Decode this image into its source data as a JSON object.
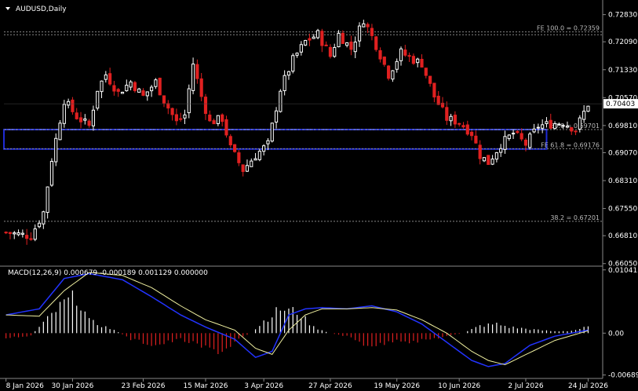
{
  "chart_data": [
    {
      "type": "candlestick",
      "title": "AUDUSD,Daily",
      "price_ticks": [
        "0.72830",
        "0.72090",
        "0.71330",
        "0.70570",
        "0.69810",
        "0.69070",
        "0.68310",
        "0.67550",
        "0.66810",
        "0.66050"
      ],
      "price_tick_values": [
        0.7283,
        0.7209,
        0.7133,
        0.7057,
        0.6981,
        0.6907,
        0.6831,
        0.6755,
        0.6681,
        0.6605
      ],
      "ylim": [
        0.6598,
        0.731
      ],
      "current_price": "0.70403",
      "current_price_value": 0.70403,
      "levels": [
        {
          "label": "FE 100.0 = 0.72359",
          "value": 0.72359,
          "style": "dashed",
          "color": "#888888"
        },
        {
          "label": "",
          "value": 0.72283,
          "style": "dashed",
          "color": "#888888"
        },
        {
          "label": "50.0 = 0.69701",
          "value": 0.69701,
          "style": "dashed",
          "color": "#888888"
        },
        {
          "label": "FE 61.8 = 0.69176",
          "value": 0.69176,
          "style": "dashed",
          "color": "#888888"
        },
        {
          "label": "38.2 = 0.67201",
          "value": 0.67201,
          "style": "dashed",
          "color": "#888888"
        }
      ],
      "zone": {
        "top": 0.697,
        "bottom": 0.6917,
        "start": 0,
        "end": 130,
        "color": "#1f2bd6",
        "style": "dashed-top"
      },
      "waypoints_close": [
        [
          0,
          0.669
        ],
        [
          6,
          0.668
        ],
        [
          9,
          0.6745
        ],
        [
          11,
          0.689
        ],
        [
          14,
          0.705
        ],
        [
          17,
          0.7005
        ],
        [
          20,
          0.698
        ],
        [
          22,
          0.708
        ],
        [
          24,
          0.712
        ],
        [
          27,
          0.707
        ],
        [
          30,
          0.71
        ],
        [
          33,
          0.706
        ],
        [
          36,
          0.71
        ],
        [
          38,
          0.705
        ],
        [
          41,
          0.699
        ],
        [
          43,
          0.701
        ],
        [
          45,
          0.715
        ],
        [
          47,
          0.706
        ],
        [
          49,
          0.699
        ],
        [
          52,
          0.7
        ],
        [
          54,
          0.692
        ],
        [
          57,
          0.686
        ],
        [
          60,
          0.69
        ],
        [
          63,
          0.693
        ],
        [
          66,
          0.708
        ],
        [
          69,
          0.716
        ],
        [
          72,
          0.721
        ],
        [
          75,
          0.723
        ],
        [
          78,
          0.717
        ],
        [
          80,
          0.723
        ],
        [
          83,
          0.719
        ],
        [
          86,
          0.727
        ],
        [
          89,
          0.72
        ],
        [
          92,
          0.712
        ],
        [
          95,
          0.718
        ],
        [
          98,
          0.716
        ],
        [
          100,
          0.715
        ],
        [
          103,
          0.706
        ],
        [
          106,
          0.7
        ],
        [
          109,
          0.699
        ],
        [
          112,
          0.696
        ],
        [
          114,
          0.69
        ],
        [
          116,
          0.688
        ],
        [
          119,
          0.693
        ],
        [
          122,
          0.696
        ],
        [
          125,
          0.693
        ],
        [
          128,
          0.698
        ],
        [
          131,
          0.6985
        ],
        [
          134,
          0.699
        ],
        [
          137,
          0.697
        ],
        [
          140,
          0.704
        ]
      ],
      "x_labels": [
        {
          "label": "8 Jan 2026",
          "bar": 0
        },
        {
          "label": "30 Jan 2026",
          "bar": 16
        },
        {
          "label": "23 Feb 2026",
          "bar": 33
        },
        {
          "label": "15 Mar 2026",
          "bar": 48
        },
        {
          "label": "3 Apr 2026",
          "bar": 62
        },
        {
          "label": "27 Apr 2026",
          "bar": 78
        },
        {
          "label": "19 May 2026",
          "bar": 94
        },
        {
          "label": "10 Jun 2026",
          "bar": 109
        },
        {
          "label": "2 Jul 2026",
          "bar": 125
        },
        {
          "label": "24 Jul 2026",
          "bar": 140
        }
      ],
      "bar_count": 141,
      "colors": {
        "up": "#ffffff",
        "down": "#e02020"
      }
    },
    {
      "type": "macd",
      "title": "MACD(12,26,9) 0.000679 -0.000189 0.001129 0.000000",
      "ticks": [
        "0.010415",
        "0.00",
        "-0.006892"
      ],
      "tick_values": [
        0.010415,
        0.0,
        -0.006892
      ],
      "ylim": [
        -0.0072,
        0.0109
      ],
      "macd_waypoints": [
        [
          0,
          0.003
        ],
        [
          8,
          0.004
        ],
        [
          14,
          0.009
        ],
        [
          20,
          0.0098
        ],
        [
          28,
          0.0088
        ],
        [
          35,
          0.006
        ],
        [
          42,
          0.003
        ],
        [
          48,
          0.001
        ],
        [
          55,
          -0.001
        ],
        [
          60,
          -0.004
        ],
        [
          64,
          -0.003
        ],
        [
          68,
          0.003
        ],
        [
          72,
          0.004
        ],
        [
          76,
          0.0042
        ],
        [
          82,
          0.004
        ],
        [
          88,
          0.0045
        ],
        [
          94,
          0.0035
        ],
        [
          100,
          0.0015
        ],
        [
          106,
          -0.0015
        ],
        [
          112,
          -0.0045
        ],
        [
          116,
          -0.0055
        ],
        [
          120,
          -0.005
        ],
        [
          126,
          -0.002
        ],
        [
          132,
          -0.0005
        ],
        [
          140,
          0.0005
        ]
      ],
      "signal_waypoints": [
        [
          0,
          0.003
        ],
        [
          8,
          0.0028
        ],
        [
          14,
          0.007
        ],
        [
          20,
          0.01
        ],
        [
          28,
          0.0095
        ],
        [
          35,
          0.0075
        ],
        [
          42,
          0.0045
        ],
        [
          48,
          0.0022
        ],
        [
          55,
          0.0005
        ],
        [
          60,
          -0.0025
        ],
        [
          64,
          -0.0035
        ],
        [
          68,
          0.0005
        ],
        [
          72,
          0.003
        ],
        [
          76,
          0.004
        ],
        [
          82,
          0.004
        ],
        [
          88,
          0.0042
        ],
        [
          94,
          0.0038
        ],
        [
          100,
          0.0022
        ],
        [
          106,
          0.0
        ],
        [
          112,
          -0.003
        ],
        [
          116,
          -0.0045
        ],
        [
          120,
          -0.0052
        ],
        [
          126,
          -0.0032
        ],
        [
          132,
          -0.0012
        ],
        [
          140,
          0.0004
        ]
      ],
      "histogram_waypoints": [
        [
          0,
          -0.0008
        ],
        [
          6,
          -0.0004
        ],
        [
          8,
          0.001
        ],
        [
          14,
          0.005
        ],
        [
          17,
          0.006
        ],
        [
          20,
          0.002
        ],
        [
          26,
          0.0005
        ],
        [
          30,
          -0.001
        ],
        [
          36,
          -0.002
        ],
        [
          42,
          -0.001
        ],
        [
          48,
          -0.0025
        ],
        [
          52,
          -0.003
        ],
        [
          56,
          -0.001
        ],
        [
          59,
          0.0
        ],
        [
          62,
          0.002
        ],
        [
          66,
          0.004
        ],
        [
          70,
          0.0035
        ],
        [
          74,
          0.001
        ],
        [
          78,
          0.0
        ],
        [
          82,
          -0.0005
        ],
        [
          86,
          -0.0018
        ],
        [
          90,
          -0.002
        ],
        [
          94,
          -0.001
        ],
        [
          98,
          -0.0015
        ],
        [
          102,
          -0.001
        ],
        [
          106,
          -0.0005
        ],
        [
          110,
          0.0
        ],
        [
          114,
          0.0012
        ],
        [
          118,
          0.0015
        ],
        [
          121,
          0.001
        ],
        [
          124,
          0.0008
        ],
        [
          128,
          0.0005
        ],
        [
          132,
          0.0003
        ],
        [
          136,
          0.0004
        ],
        [
          140,
          0.001
        ]
      ],
      "colors": {
        "macd": "#2233ff",
        "signal": "#f0f0a0",
        "hist_up": "#ffffff",
        "hist_down": "#e02020"
      }
    }
  ]
}
